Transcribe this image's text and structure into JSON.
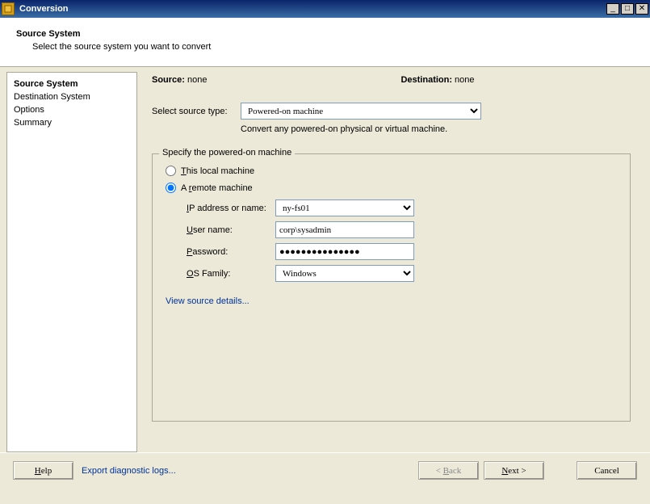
{
  "window": {
    "title": "Conversion"
  },
  "header": {
    "title": "Source System",
    "subtitle": "Select the source system you want to convert"
  },
  "sidebar": {
    "items": [
      {
        "label": "Source System",
        "active": true
      },
      {
        "label": "Destination System"
      },
      {
        "label": "Options"
      },
      {
        "label": "Summary"
      }
    ]
  },
  "srcdest": {
    "source_label": "Source:",
    "source_value": "none",
    "dest_label": "Destination:",
    "dest_value": "none"
  },
  "sourceType": {
    "label": "Select source type:",
    "value": "Powered-on machine",
    "hint": "Convert any powered-on physical or virtual machine."
  },
  "fieldset": {
    "legend": "Specify the powered-on machine",
    "radio_local": "This local machine",
    "radio_remote": "A remote machine",
    "selected": "remote",
    "ip_label": "IP address or name:",
    "ip_value": "ny-fs01",
    "user_label": "User name:",
    "user_value": "corp\\sysadmin",
    "pass_label": "Password:",
    "pass_value": "●●●●●●●●●●●●●●●",
    "os_label": "OS Family:",
    "os_value": "Windows",
    "view_details": "View source details..."
  },
  "footer": {
    "help": "Help",
    "diag": "Export diagnostic logs...",
    "back": "< Back",
    "next": "Next >",
    "cancel": "Cancel"
  }
}
